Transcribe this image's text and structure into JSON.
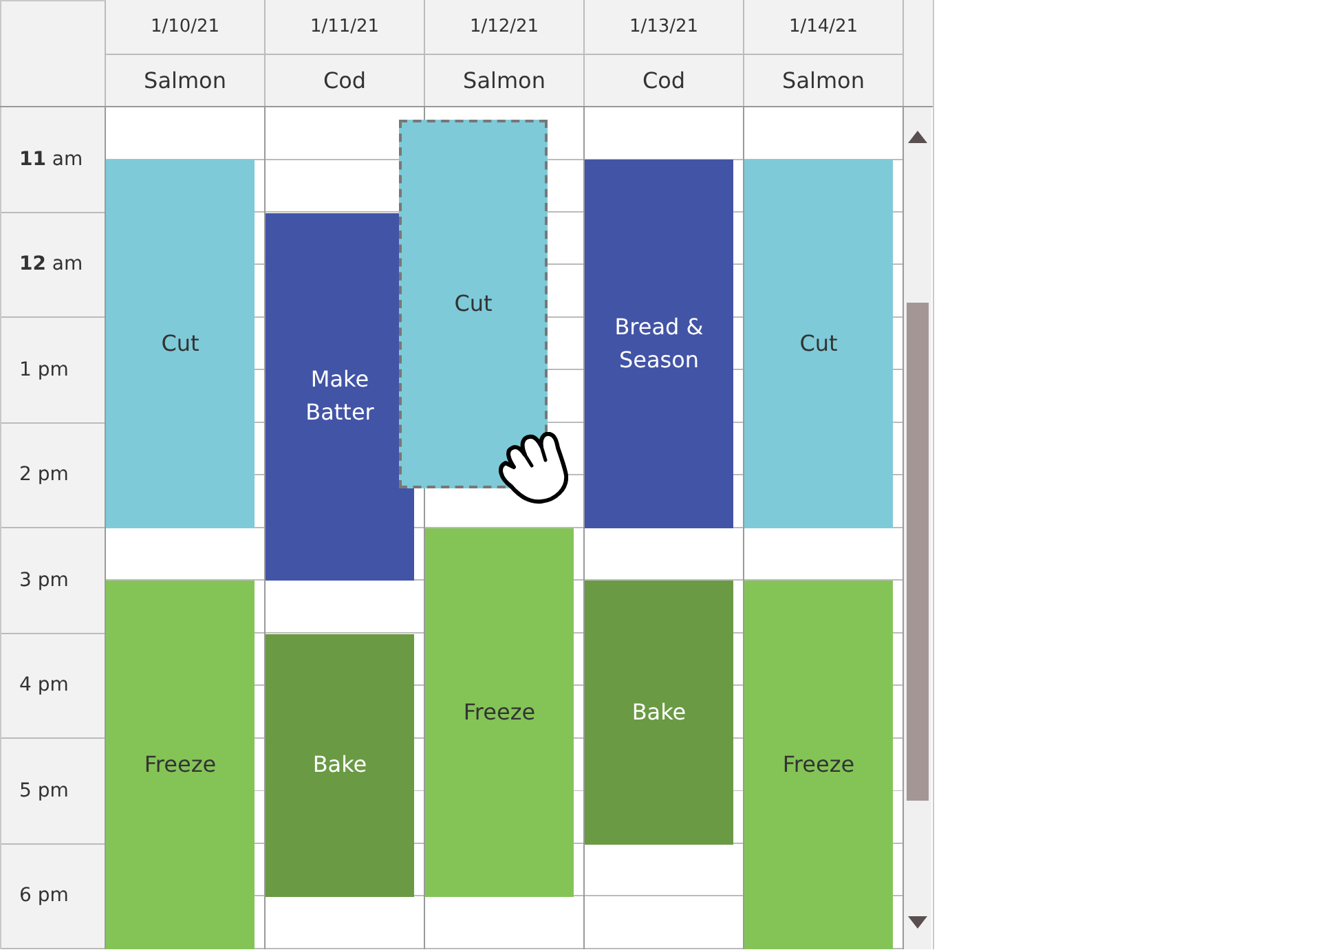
{
  "columns": [
    {
      "date": "1/10/21",
      "fish": "Salmon",
      "events": [
        {
          "label": "Cut",
          "color": "#7ecad8",
          "dragging": false
        },
        {
          "label": "Freeze",
          "color": "#84c457",
          "dragging": false
        }
      ]
    },
    {
      "date": "1/11/21",
      "fish": "Cod",
      "events": [
        {
          "label": "Make Batter",
          "color": "#4254a6",
          "dragging": false
        },
        {
          "label": "Bake",
          "color": "#6a9a44",
          "dragging": false
        }
      ]
    },
    {
      "date": "1/12/21",
      "fish": "Salmon",
      "events": [
        {
          "label": "Cut",
          "color": "#7ecad8",
          "dragging": true
        },
        {
          "label": "Freeze",
          "color": "#84c457",
          "dragging": false
        }
      ]
    },
    {
      "date": "1/13/21",
      "fish": "Cod",
      "events": [
        {
          "label": "Bread & Season",
          "color": "#4254a6",
          "dragging": false
        },
        {
          "label": "Bake",
          "color": "#6a9a44",
          "dragging": false
        }
      ]
    },
    {
      "date": "1/14/21",
      "fish": "Salmon",
      "events": [
        {
          "label": "Cut",
          "color": "#7ecad8",
          "dragging": false
        },
        {
          "label": "Freeze",
          "color": "#84c457",
          "dragging": false
        }
      ]
    }
  ],
  "hours": [
    "**11** am",
    "**12** am",
    "1 pm",
    "2 pm",
    "3 pm",
    "4 pm",
    "5 pm",
    "6 pm"
  ]
}
